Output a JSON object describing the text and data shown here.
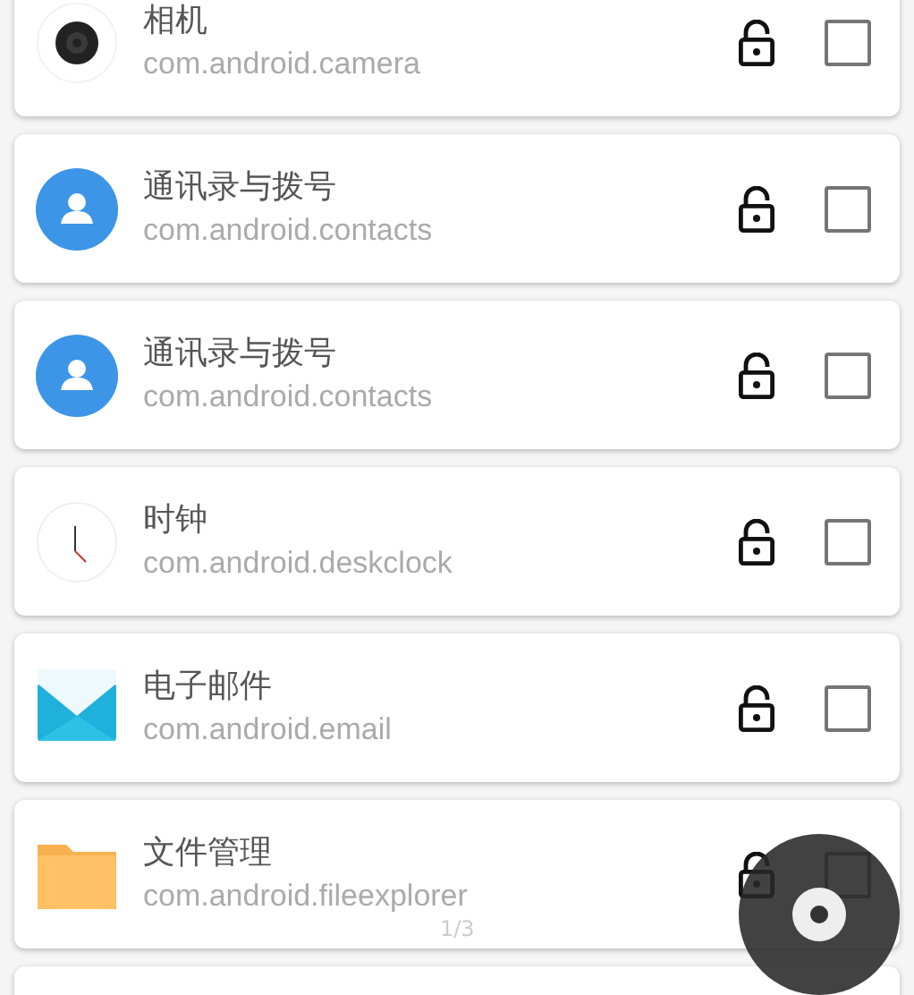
{
  "apps": [
    {
      "kind": "camera",
      "name": "相机",
      "package": "com.android.camera",
      "locked": false,
      "checked": false
    },
    {
      "kind": "contacts",
      "name": "通讯录与拨号",
      "package": "com.android.contacts",
      "locked": false,
      "checked": false
    },
    {
      "kind": "contacts",
      "name": "通讯录与拨号",
      "package": "com.android.contacts",
      "locked": false,
      "checked": false
    },
    {
      "kind": "clock",
      "name": "时钟",
      "package": "com.android.deskclock",
      "locked": false,
      "checked": false
    },
    {
      "kind": "email",
      "name": "电子邮件",
      "package": "com.android.email",
      "locked": false,
      "checked": false
    },
    {
      "kind": "folder",
      "name": "文件管理",
      "package": "com.android.fileexplorer",
      "locked": false,
      "checked": false
    }
  ],
  "page_indicator": "1/3"
}
